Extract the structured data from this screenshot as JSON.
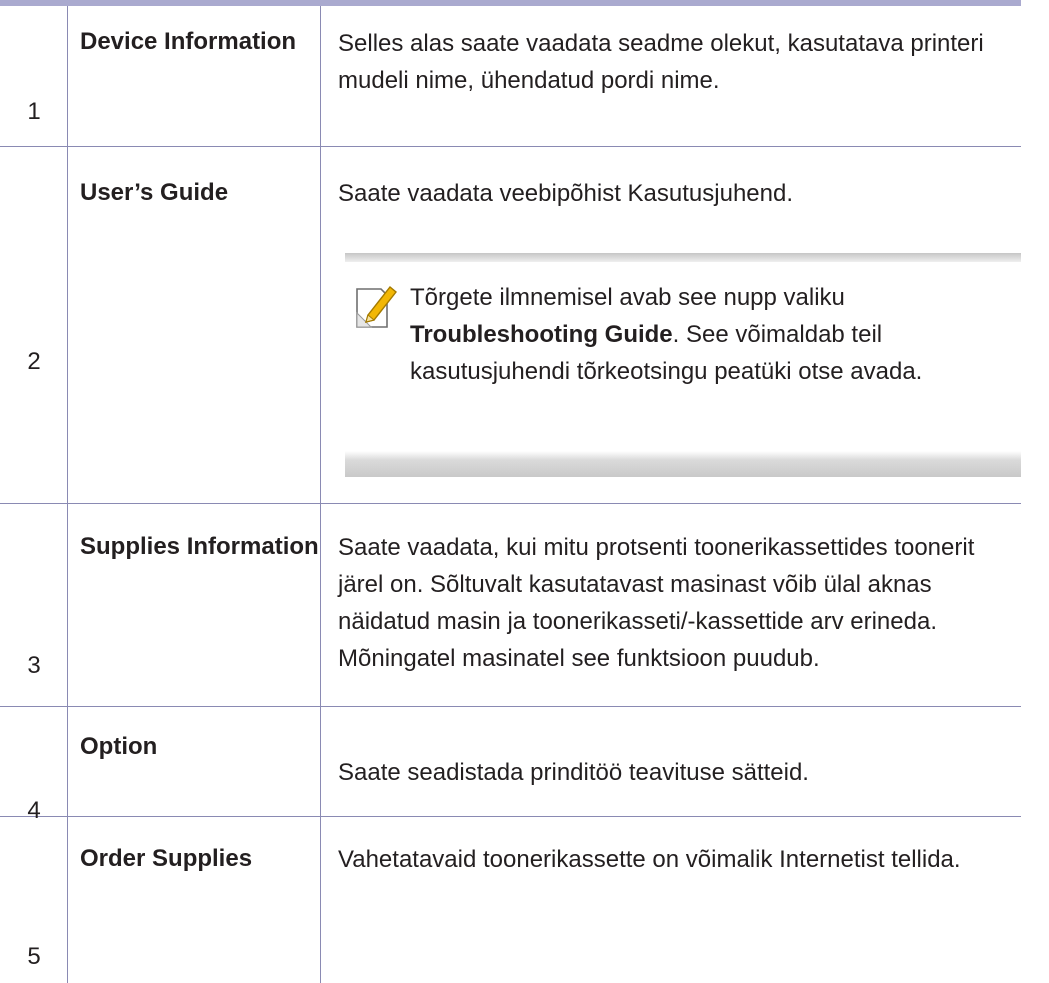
{
  "table": {
    "rows": [
      {
        "number": "1",
        "term": "Device Information",
        "description": "Selles alas saate vaadata seadme olekut, kasutatava printeri mudeli nime, ühendatud pordi nime."
      },
      {
        "number": "2",
        "term": "User’s Guide",
        "description": "Saate vaadata veebipõhist Kasutusjuhend.",
        "note": {
          "icon": "note-pencil-icon",
          "text_before": "Tõrgete ilmnemisel avab see nupp valiku ",
          "text_bold": "Troubleshooting Guide",
          "text_after": ". See võimaldab teil kasutusjuhendi tõrkeotsingu peatüki otse avada."
        }
      },
      {
        "number": "3",
        "term": "Supplies Information",
        "description": "Saate vaadata, kui mitu protsenti toonerikassettides toonerit järel on. Sõltuvalt kasutatavast masinast võib ülal aknas näidatud masin ja toonerikasseti/-kassettide arv erineda. Mõningatel masinatel see funktsioon puudub."
      },
      {
        "number": "4",
        "term": "Option",
        "description": "Saate seadistada prinditöö teavituse sätteid."
      },
      {
        "number": "5",
        "term": "Order Supplies",
        "description": "Vahetatavaid toonerikassette on võimalik Internetist tellida."
      }
    ]
  },
  "colors": {
    "top_rule": "#aaaacf",
    "rule": "#8a8ab3",
    "text": "#231f20",
    "note_icon": "#f2b705"
  }
}
